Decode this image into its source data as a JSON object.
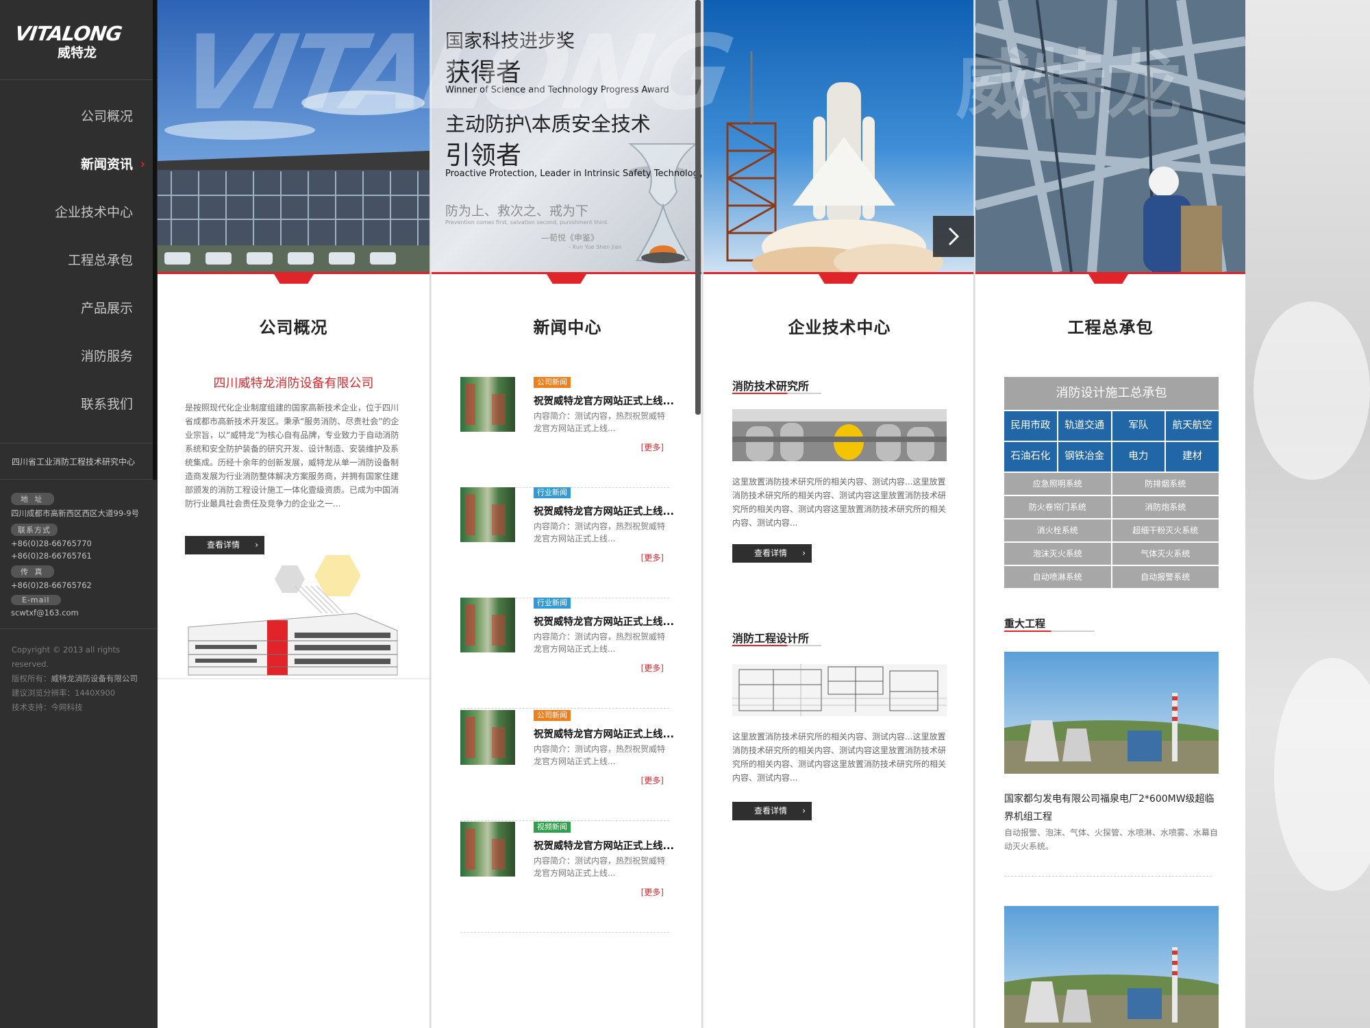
{
  "logo": {
    "en": "VITALONG",
    "cn": "威特龙"
  },
  "nav": [
    {
      "label": "公司概况",
      "active": false
    },
    {
      "label": "新闻资讯",
      "active": true
    },
    {
      "label": "企业技术中心",
      "active": false
    },
    {
      "label": "工程总承包",
      "active": false
    },
    {
      "label": "产品展示",
      "active": false
    },
    {
      "label": "消防服务",
      "active": false
    },
    {
      "label": "联系我们",
      "active": false
    }
  ],
  "nav_arrow": "›",
  "sidebar": {
    "org": "四川省工业消防工程技术研究中心",
    "address_label": "地  址",
    "address": "四川成都市高新西区西区大道99-9号",
    "contact_label": "联系方式",
    "phone1": "+86(0)28-66765770",
    "phone2": "+86(0)28-66765761",
    "fax_label": "传  真",
    "fax": "+86(0)28-66765762",
    "email_label": "E-mail",
    "email": "scwtxf@163.com",
    "copyright": "Copyright © 2013 all rights reserved.",
    "owner_prefix": "版权所有：",
    "owner": "威特龙消防设备有限公司",
    "resolution": "建议浏览分辨率：1440X900",
    "support": "技术支持：今网科技"
  },
  "hero": {
    "watermark_en": "VITALONG",
    "watermark_cn": "威特龙",
    "award_line1": "国家科技进步奖",
    "award_line2": "获得者",
    "award_en": "Winner of Science and Technology Progress Award",
    "lead_line1": "主动防护\\本质安全技术",
    "lead_line2": "引领者",
    "lead_en": "Proactive Protection, Leader in Intrinsic Safety Technology",
    "quote_cn": "防为上、救次之、戒为下",
    "quote_en": "Prevention comes first, salvation second, punishment third.",
    "quote_src": "—荀悦《申鉴》",
    "quote_src_en": "- Xun Yue Shen Jian",
    "next_icon": "chevron-right-icon"
  },
  "col1": {
    "title": "公司概况",
    "company": "四川威特龙消防设备有限公司",
    "text": "是按照现代化企业制度组建的国家高新技术企业，位于四川省成都市高新技术开发区。秉承“服务消防、尽责社会”的企业宗旨，以“威特龙”为核心自有品牌，专业致力于自动消防系统和安全防护装备的研究开发、设计制造、安装维护及系统集成。历经十余年的创新发展，威特龙从单一消防设备制造商发展为行业消防整体解决方案服务商，并拥有国家住建部颁发的消防工程设计施工一体化壹级资质。已成为中国消防行业最具社会责任及竞争力的企业之一...",
    "button": "查看详情"
  },
  "col2": {
    "title": "新闻中心",
    "news": [
      {
        "badge": "公司新闻",
        "badge_color": "#ef7f1a",
        "title": "祝贺威特龙官方网站正式上线...",
        "desc": "内容简介：测试内容，热烈祝贺威特龙官方网站正式上线...",
        "more": "[更多]"
      },
      {
        "badge": "行业新闻",
        "badge_color": "#2f9ad8",
        "title": "祝贺威特龙官方网站正式上线...",
        "desc": "内容简介：测试内容，热烈祝贺威特龙官方网站正式上线...",
        "more": "[更多]"
      },
      {
        "badge": "行业新闻",
        "badge_color": "#2f9ad8",
        "title": "祝贺威特龙官方网站正式上线...",
        "desc": "内容简介：测试内容，热烈祝贺威特龙官方网站正式上线...",
        "more": "[更多]"
      },
      {
        "badge": "公司新闻",
        "badge_color": "#ef7f1a",
        "title": "祝贺威特龙官方网站正式上线...",
        "desc": "内容简介：测试内容，热烈祝贺威特龙官方网站正式上线...",
        "more": "[更多]"
      },
      {
        "badge": "视频新闻",
        "badge_color": "#2fa04a",
        "title": "祝贺威特龙官方网站正式上线...",
        "desc": "内容简介：测试内容，热烈祝贺威特龙官方网站正式上线...",
        "more": "[更多]"
      }
    ]
  },
  "col3": {
    "title": "企业技术中心",
    "sec1_title": "消防技术研究所",
    "sec1_text": "这里放置消防技术研究所的相关内容、测试内容...这里放置消防技术研究所的相关内容、测试内容这里放置消防技术研究所的相关内容、测试内容这里放置消防技术研究所的相关内容、测试内容...",
    "sec2_title": "消防工程设计所",
    "sec2_text": "这里放置消防技术研究所的相关内容、测试内容...这里放置消防技术研究所的相关内容、测试内容这里放置消防技术研究所的相关内容、测试内容这里放置消防技术研究所的相关内容、测试内容...",
    "button": "查看详情"
  },
  "col4": {
    "title": "工程总承包",
    "box_title": "消防设计施工总承包",
    "blue": [
      "民用市政",
      "轨道交通",
      "军队",
      "航天航空",
      "石油石化",
      "钢铁冶金",
      "电力",
      "建材"
    ],
    "gray": [
      "应急照明系统",
      "防排烟系统",
      "防火卷帘门系统",
      "消防炮系统",
      "消火栓系统",
      "超细干粉灭火系统",
      "泡沫灭火系统",
      "气体灭火系统",
      "自动喷淋系统",
      "自动报警系统"
    ],
    "major_title": "重大工程",
    "project_title": "国家都匀发电有限公司福泉电厂2*600MW级超临界机组工程",
    "project_desc": "自动报警、泡沫、气体、火探管、水喷淋、水喷雾、水幕自动灭火系统。"
  }
}
